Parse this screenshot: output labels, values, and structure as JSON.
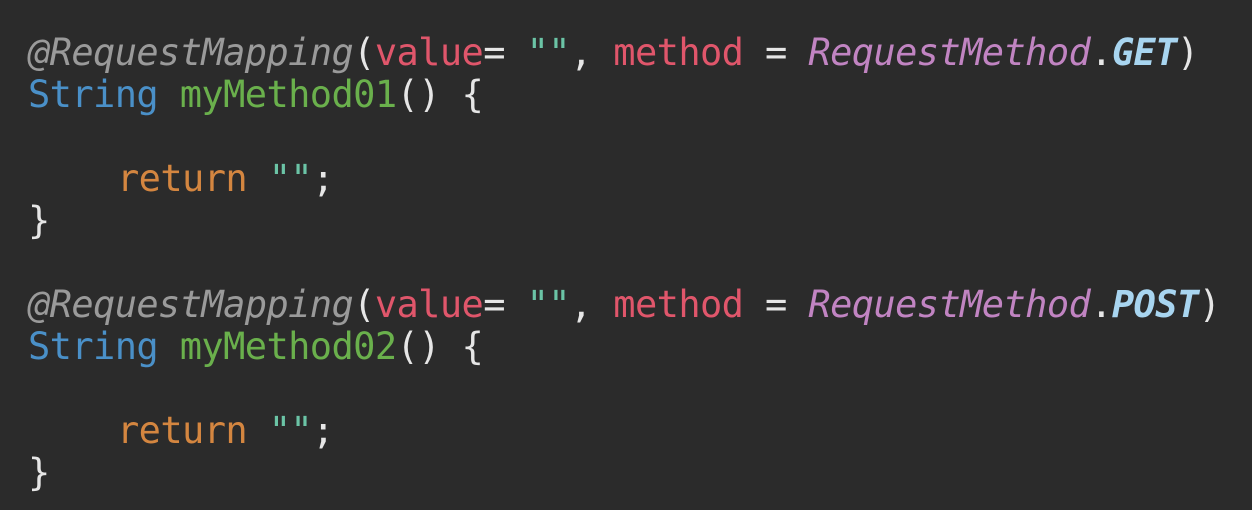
{
  "colors": {
    "background": "#2b2b2b",
    "annotation": "#9a9a9a",
    "param": "#e0566b",
    "string": "#6bc4a6",
    "enum_class": "#c184c2",
    "enum_const": "#a8d5f0",
    "type": "#4a90c8",
    "method_name": "#6ab04c",
    "keyword": "#d48640",
    "default_text": "#e6e6e6"
  },
  "blocks": [
    {
      "annotation": "@RequestMapping",
      "open_paren": "(",
      "value_param": "value",
      "eq1": "= ",
      "value_string": "\"\"",
      "comma": ", ",
      "method_param": "method",
      "eq2": " = ",
      "enum_class": "RequestMethod",
      "dot": ".",
      "enum_const": "GET",
      "close_paren": ")",
      "return_type": "String",
      "method_name": "myMethod01",
      "signature_rest": "() {",
      "return_keyword": "return",
      "return_value": "\"\"",
      "semicolon": ";",
      "close_brace": "}"
    },
    {
      "annotation": "@RequestMapping",
      "open_paren": "(",
      "value_param": "value",
      "eq1": "= ",
      "value_string": "\"\"",
      "comma": ", ",
      "method_param": "method",
      "eq2": " = ",
      "enum_class": "RequestMethod",
      "dot": ".",
      "enum_const": "POST",
      "close_paren": ")",
      "return_type": "String",
      "method_name": "myMethod02",
      "signature_rest": "() {",
      "return_keyword": "return",
      "return_value": "\"\"",
      "semicolon": ";",
      "close_brace": "}"
    }
  ]
}
